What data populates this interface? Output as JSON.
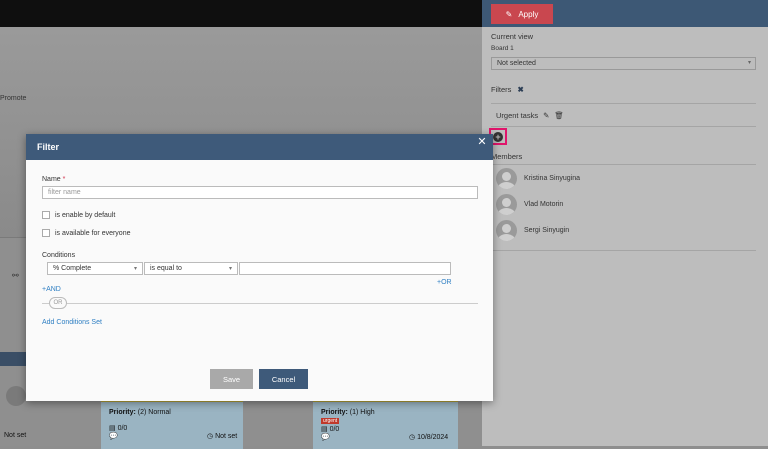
{
  "background": {
    "promote_label": "Promote",
    "left_not_set": "Not set",
    "card1": {
      "priority": "Priority:",
      "priority_value": "(2) Normal",
      "tasks": "0/0",
      "date": "Not set"
    },
    "card2": {
      "priority": "Priority:",
      "priority_value": "(1) High",
      "badge": "urgent",
      "tasks": "0/0",
      "date": "10/8/2024"
    }
  },
  "right_panel": {
    "apply_label": "Apply",
    "current_view_label": "Current view",
    "board_label": "Board 1",
    "view_select_value": "Not selected",
    "filters_label": "Filters",
    "filter_items": [
      {
        "label": "Urgent tasks"
      }
    ],
    "members_label": "Members",
    "members": [
      {
        "name": "Kristina Sinyugina"
      },
      {
        "name": "Vlad Motorin"
      },
      {
        "name": "Sergi Sinyugin"
      }
    ]
  },
  "modal": {
    "title": "Filter",
    "name_label": "Name",
    "name_required_mark": "*",
    "name_placeholder": "filter name",
    "enable_by_default_label": "is enable by default",
    "available_for_everyone_label": "is available for everyone",
    "conditions_label": "Conditions",
    "field_select_value": "% Complete",
    "operator_select_value": "is equal to",
    "or_label": "+OR",
    "and_label": "+AND",
    "or_divider_label": "OR",
    "add_conditions_set_label": "Add Conditions Set",
    "save_label": "Save",
    "cancel_label": "Cancel"
  },
  "colors": {
    "header": "#3e5a7a",
    "apply": "#c9474f",
    "highlight": "#e0156b",
    "link": "#2f7fc3",
    "save": "#a9a9a9",
    "cancel": "#3e5a7a"
  }
}
